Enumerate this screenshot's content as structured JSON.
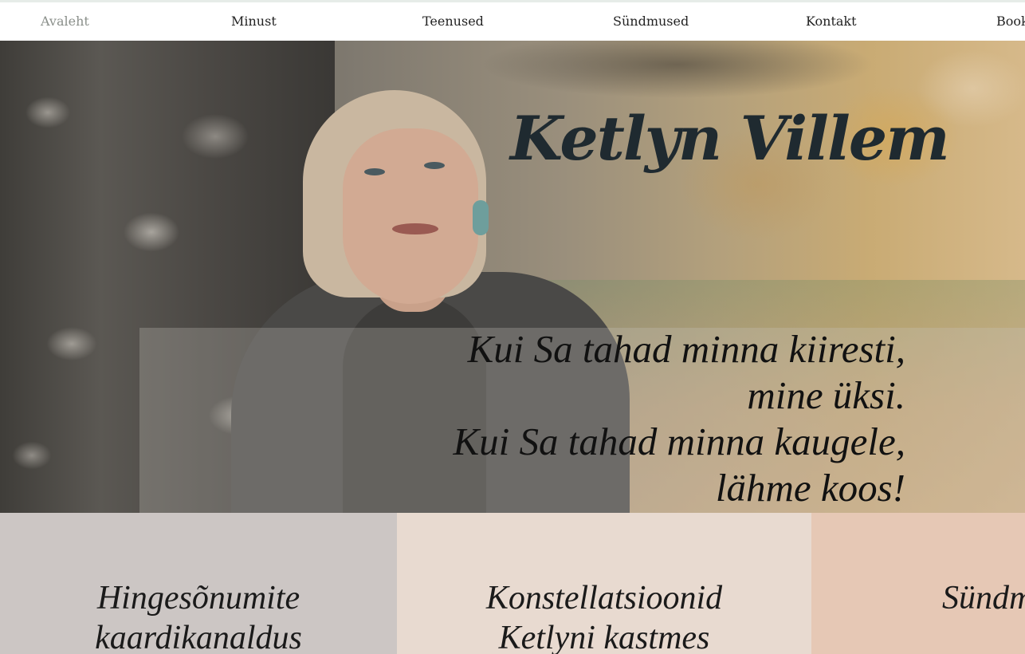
{
  "nav": {
    "items": [
      {
        "label": "Avaleht",
        "active": true
      },
      {
        "label": "Minust"
      },
      {
        "label": "Teenused"
      },
      {
        "label": "Sündmused"
      },
      {
        "label": "Kontakt"
      },
      {
        "label": "Book"
      }
    ]
  },
  "hero": {
    "title": "Ketlyn Villem",
    "quote_lines": [
      "Kui Sa tahad minna kiiresti,",
      "mine üksi.",
      "Kui Sa tahad minna kaugele,",
      "lähme koos!"
    ]
  },
  "services": [
    {
      "lines": [
        "Hingesõnumite",
        "kaardikanaldus"
      ],
      "color": "#ccc6c4"
    },
    {
      "lines": [
        "Konstellatsioonid",
        "Ketlyni kastmes"
      ],
      "color": "#e8dad0"
    },
    {
      "lines": [
        "Sündmused"
      ],
      "color": "#e6c8b5"
    }
  ],
  "colors": {
    "nav_active": "#8a8f8a",
    "title": "#1f2a30"
  }
}
